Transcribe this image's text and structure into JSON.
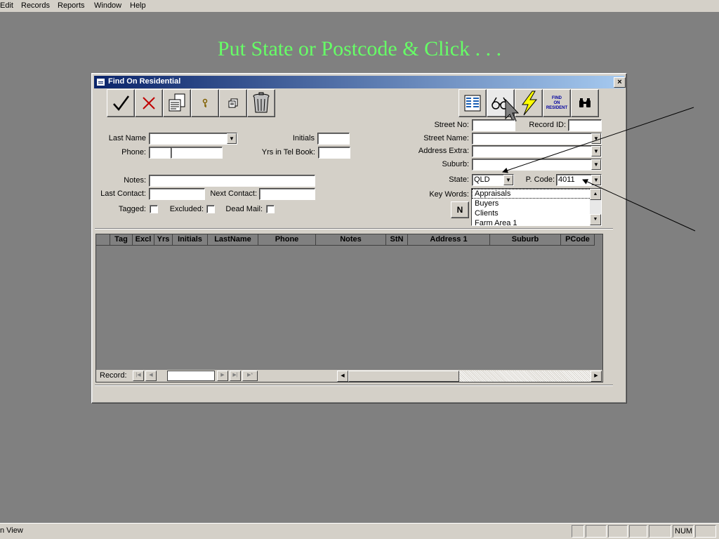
{
  "menu": [
    "Edit",
    "Records",
    "Reports",
    "Window",
    "Help"
  ],
  "heading": "Put State or Postcode & Click . . .",
  "window": {
    "title": "Find On Residential",
    "close": "×"
  },
  "toolbar": {
    "find_on_label_1": "FIND",
    "find_on_label_2": "ON",
    "find_on_label_3": "RESIDENT"
  },
  "left_form": {
    "last_name": "Last Name",
    "initials": "Initials",
    "phone": "Phone:",
    "yrs_tel": "Yrs in Tel Book:",
    "notes": "Notes:",
    "last_contact": "Last Contact:",
    "next_contact": "Next Contact:",
    "tagged": "Tagged:",
    "excluded": "Excluded:",
    "dead_mail": "Dead Mail:"
  },
  "right_form": {
    "street_no": "Street No:",
    "record_id": "Record ID:",
    "street_name": "Street Name:",
    "address_extra": "Address Extra:",
    "suburb": "Suburb:",
    "state": "State:",
    "state_value": "QLD",
    "pcode": "P. Code:",
    "pcode_value": "4011",
    "key_words": "Key Words:",
    "n_button": "N"
  },
  "keywords": [
    "Appraisals",
    "Buyers",
    "Clients",
    "Farm Area 1"
  ],
  "columns": [
    "Tag",
    "Excl",
    "Yrs",
    "Initials",
    "LastName",
    "Phone",
    "Notes",
    "StN",
    "Address 1",
    "Suburb",
    "PCode"
  ],
  "nav": {
    "record_label": "Record:"
  },
  "status": {
    "left": "n View",
    "num": "NUM"
  }
}
